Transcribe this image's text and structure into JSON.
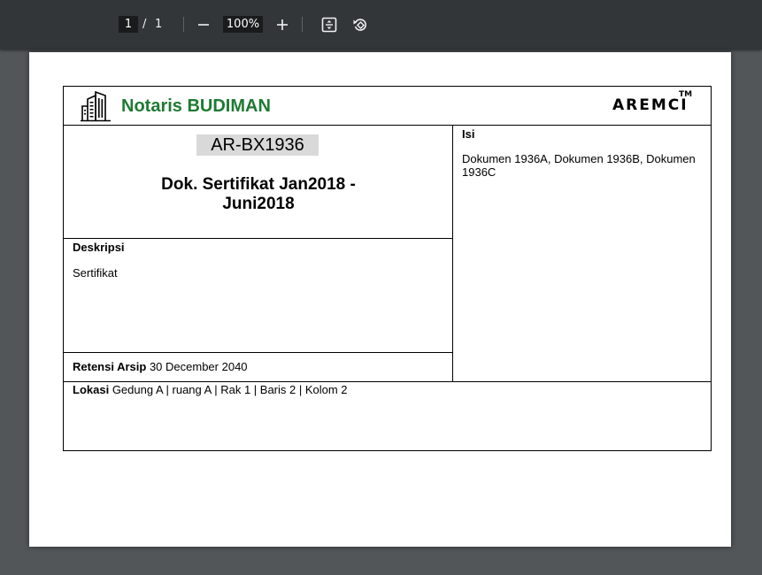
{
  "toolbar": {
    "current_page": "1",
    "page_separator": "/",
    "total_pages": "1",
    "zoom": "100%"
  },
  "document": {
    "brand": "Notaris BUDIMAN",
    "logo_text": "AREMCI",
    "trademark": "TM",
    "code": "AR-BX1936",
    "title_line1": "Dok. Sertifikat Jan2018 -",
    "title_line2": "Juni2018",
    "isi_label": "Isi",
    "isi_line1": "Dokumen 1936A, Dokumen 1936B, Dokumen",
    "isi_line2": "1936C",
    "deskripsi_label": "Deskripsi",
    "deskripsi_value": "Sertifikat",
    "retensi_label": "Retensi Arsip",
    "retensi_value": "30 December 2040",
    "lokasi_label": "Lokasi",
    "lokasi_value": "Gedung A | ruang A | Rak 1 | Baris 2 | Kolom 2"
  },
  "colors": {
    "brand_green": "#1e7a33",
    "toolbar_bg": "#323639",
    "viewer_bg": "#525659"
  }
}
